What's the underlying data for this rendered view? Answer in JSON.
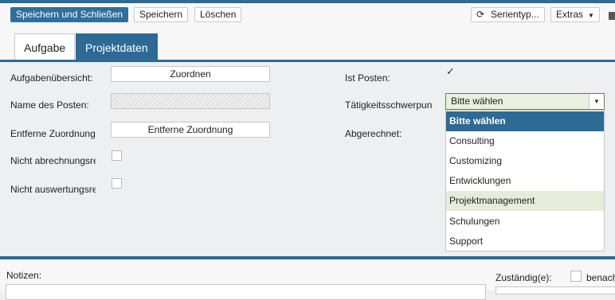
{
  "toolbar": {
    "save_close_label": "Speichern und Schließen",
    "save_label": "Speichern",
    "delete_label": "Löschen",
    "series_label": "Serientyp...",
    "extras_label": "Extras"
  },
  "tabs": [
    {
      "label": "Aufgabe"
    },
    {
      "label": "Projektdaten"
    }
  ],
  "form": {
    "overview_label": "Aufgabenübersicht:",
    "assign_button": "Zuordnen",
    "item_name_label": "Name des Posten:",
    "remote_assignment_label": "Entferne Zuordnung",
    "remote_assignment_button": "Entferne Zuordnung",
    "not_billable_label": "Nicht abrechnungsre",
    "not_evaluable_label": "Nicht auswertungsre",
    "is_item_label": "Ist Posten:",
    "is_item_checked": true,
    "focus_label": "Tätigkeitsschwerpun",
    "focus_value": "Bitte wählen",
    "settled_label": "Abgerechnet:"
  },
  "dropdown": {
    "options": [
      "Bitte wählen",
      "Consulting",
      "Customizing",
      "Entwicklungen",
      "Projektmanagement",
      "Schulungen",
      "Support"
    ],
    "selected": "Bitte wählen",
    "highlighted": "Projektmanagement"
  },
  "bottom": {
    "notes_label": "Notizen:",
    "responsible_label": "Zuständig(e):",
    "notify_label": "benach"
  },
  "colors": {
    "accent": "#2d6a96",
    "select_border": "#3a9a3a",
    "hover_row": "#e5ecdc"
  }
}
